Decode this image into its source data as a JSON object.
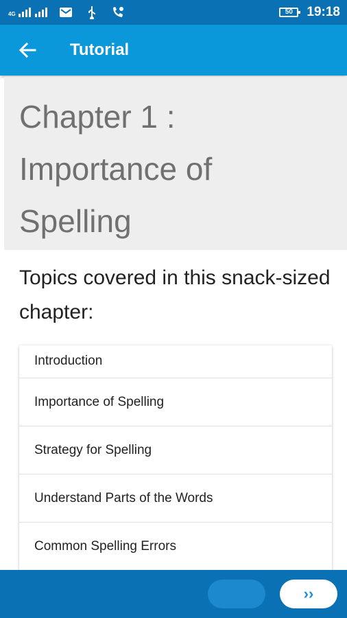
{
  "status_bar": {
    "network": "4G",
    "battery": "50",
    "time": "19:18",
    "icons": [
      "signal-icon",
      "mail-icon",
      "usb-icon",
      "phone-icon",
      "battery-icon"
    ]
  },
  "app_bar": {
    "title": "Tutorial",
    "back_icon": "arrow-back-icon"
  },
  "chapter": {
    "title": "Chapter 1 : Importance of Spelling"
  },
  "topics_heading": "Topics covered in this snack-sized chapter:",
  "topics": [
    {
      "label": "Introduction"
    },
    {
      "label": "Importance of Spelling"
    },
    {
      "label": "Strategy for Spelling"
    },
    {
      "label": "Understand Parts of the Words"
    },
    {
      "label": "Common Spelling Errors"
    }
  ],
  "bottom_bar": {
    "prev_label": "",
    "next_label": "››"
  },
  "colors": {
    "status_bar": "#0a71b5",
    "app_bar": "#0b98db",
    "chapter_bg": "#eeeeee",
    "accent": "#1a8fd8"
  }
}
